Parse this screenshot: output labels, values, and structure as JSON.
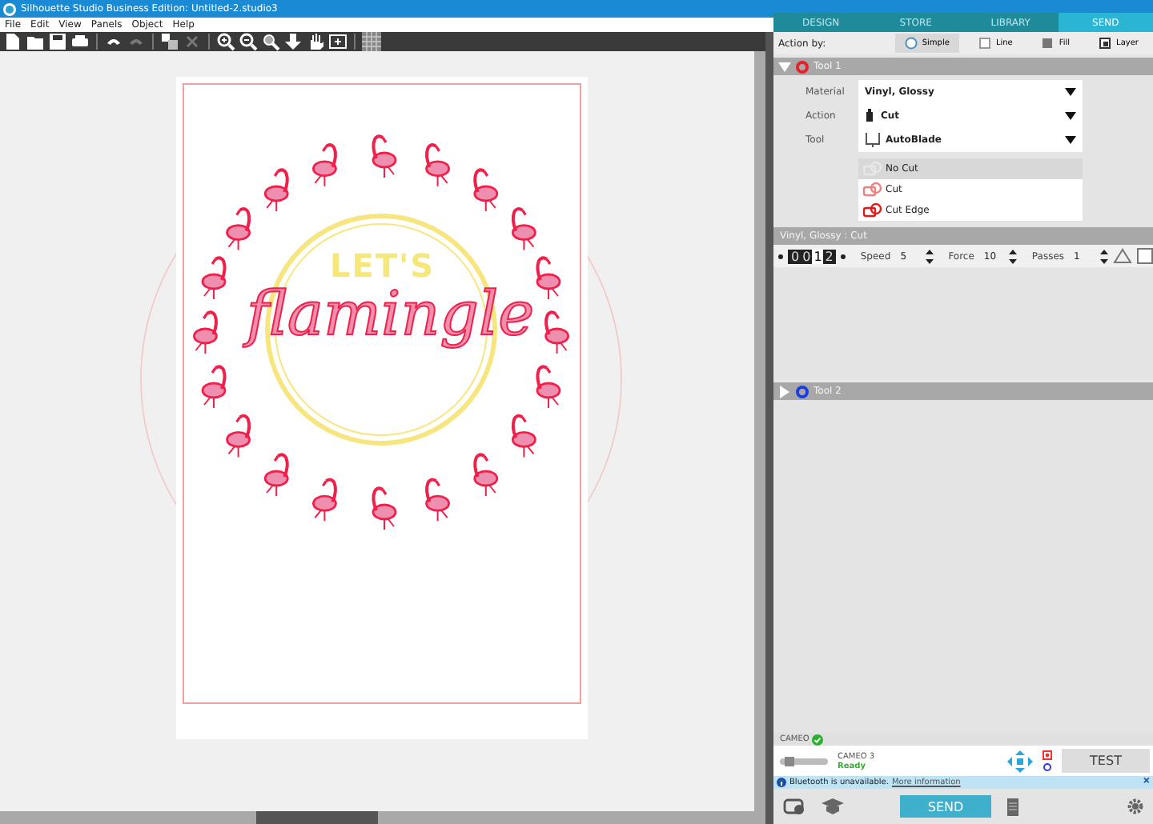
{
  "window": {
    "title": "Silhouette Studio Business Edition: Untitled-2.studio3"
  },
  "menu": [
    "File",
    "Edit",
    "View",
    "Panels",
    "Object",
    "Help"
  ],
  "design": {
    "line_1": "LET'S",
    "line_2": "flamingle"
  },
  "nav_tabs": [
    {
      "label": "DESIGN",
      "selected": false
    },
    {
      "label": "STORE",
      "selected": false
    },
    {
      "label": "LIBRARY",
      "selected": false
    },
    {
      "label": "SEND",
      "selected": true
    }
  ],
  "action_by": {
    "label": "Action by:",
    "options": [
      {
        "label": "Simple",
        "selected": true
      },
      {
        "label": "Line",
        "selected": false
      },
      {
        "label": "Fill",
        "selected": false
      },
      {
        "label": "Layer",
        "selected": false
      }
    ]
  },
  "tools": [
    {
      "name": "Tool 1",
      "expanded": true,
      "color": "#e8202a"
    },
    {
      "name": "Tool 2",
      "expanded": false,
      "color": "#1a3fe0"
    }
  ],
  "settings": [
    {
      "label": "Material",
      "value": "Vinyl, Glossy"
    },
    {
      "label": "Action",
      "value": "Cut"
    },
    {
      "label": "Tool",
      "value": "AutoBlade"
    }
  ],
  "cut_options": [
    {
      "label": "No Cut",
      "selected": true
    },
    {
      "label": "Cut",
      "selected": false
    },
    {
      "label": "Cut Edge",
      "selected": false
    }
  ],
  "cut_settings": {
    "title": "Vinyl, Glossy : Cut",
    "blade": [
      {
        "label": "0",
        "selected": false
      },
      {
        "label": "0",
        "selected": false
      },
      {
        "label": "1",
        "selected": true
      },
      {
        "label": "2",
        "selected": false
      }
    ],
    "speed_label": "Speed",
    "speed": "5",
    "force_label": "Force",
    "force": "10",
    "passes_label": "Passes",
    "passes": "1"
  },
  "device": {
    "header": "CAMEO",
    "connected": true,
    "name": "CAMEO 3",
    "status": "Ready",
    "test_button": "TEST"
  },
  "notice": {
    "text": "Bluetooth is unavailable.",
    "link": "More information",
    "close": "×"
  },
  "send_button": "SEND"
}
